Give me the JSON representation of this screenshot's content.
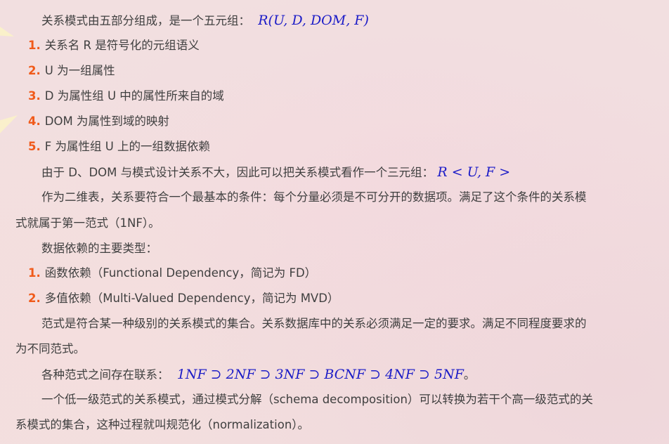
{
  "intro": {
    "text": "关系模式由五部分组成，是一个五元组：",
    "formula": "R(U, D, DOM, F)"
  },
  "components": [
    {
      "num": "1.",
      "text": "关系名 R 是符号化的元组语义"
    },
    {
      "num": "2.",
      "text": "U 为一组属性"
    },
    {
      "num": "3.",
      "text": "D 为属性组 U 中的属性所来自的域"
    },
    {
      "num": "4.",
      "text": "DOM 为属性到域的映射"
    },
    {
      "num": "5.",
      "text": "F 为属性组 U 上的一组数据依赖"
    }
  ],
  "simplified": {
    "text": "由于 D、DOM 与模式设计关系不大，因此可以把关系模式看作一个三元组：",
    "formula": "R < U, F >"
  },
  "first_nf": {
    "line1": "作为二维表，关系要符合一个最基本的条件：每个分量必须是不可分开的数据项。满足了这个条件的关系模",
    "line2": "式就属于第一范式（1NF）。"
  },
  "dependency_heading": "数据依赖的主要类型：",
  "dependencies": [
    {
      "num": "1.",
      "text": "函数依赖（Functional Dependency，简记为 FD）"
    },
    {
      "num": "2.",
      "text": "多值依赖（Multi-Valued Dependency，简记为 MVD）"
    }
  ],
  "normal_form_def": {
    "line1": "范式是符合某一种级别的关系模式的集合。关系数据库中的关系必须满足一定的要求。满足不同程度要求的",
    "line2": "为不同范式。"
  },
  "relation": {
    "text": "各种范式之间存在联系：",
    "formula": "1NF ⊃ 2NF ⊃ 3NF ⊃ BCNF ⊃ 4NF ⊃ 5NF",
    "suffix": "。"
  },
  "normalization": {
    "line1": "一个低一级范式的关系模式，通过模式分解（schema decomposition）可以转换为若干个高一级范式的关",
    "line2": "系模式的集合，这种过程就叫规范化（normalization）。"
  },
  "colors": {
    "background": "#f2dfe0",
    "text": "#3f3f3f",
    "list_number": "#f05a1a",
    "math": "#1c1cc7",
    "star": "#fbf3c8"
  }
}
